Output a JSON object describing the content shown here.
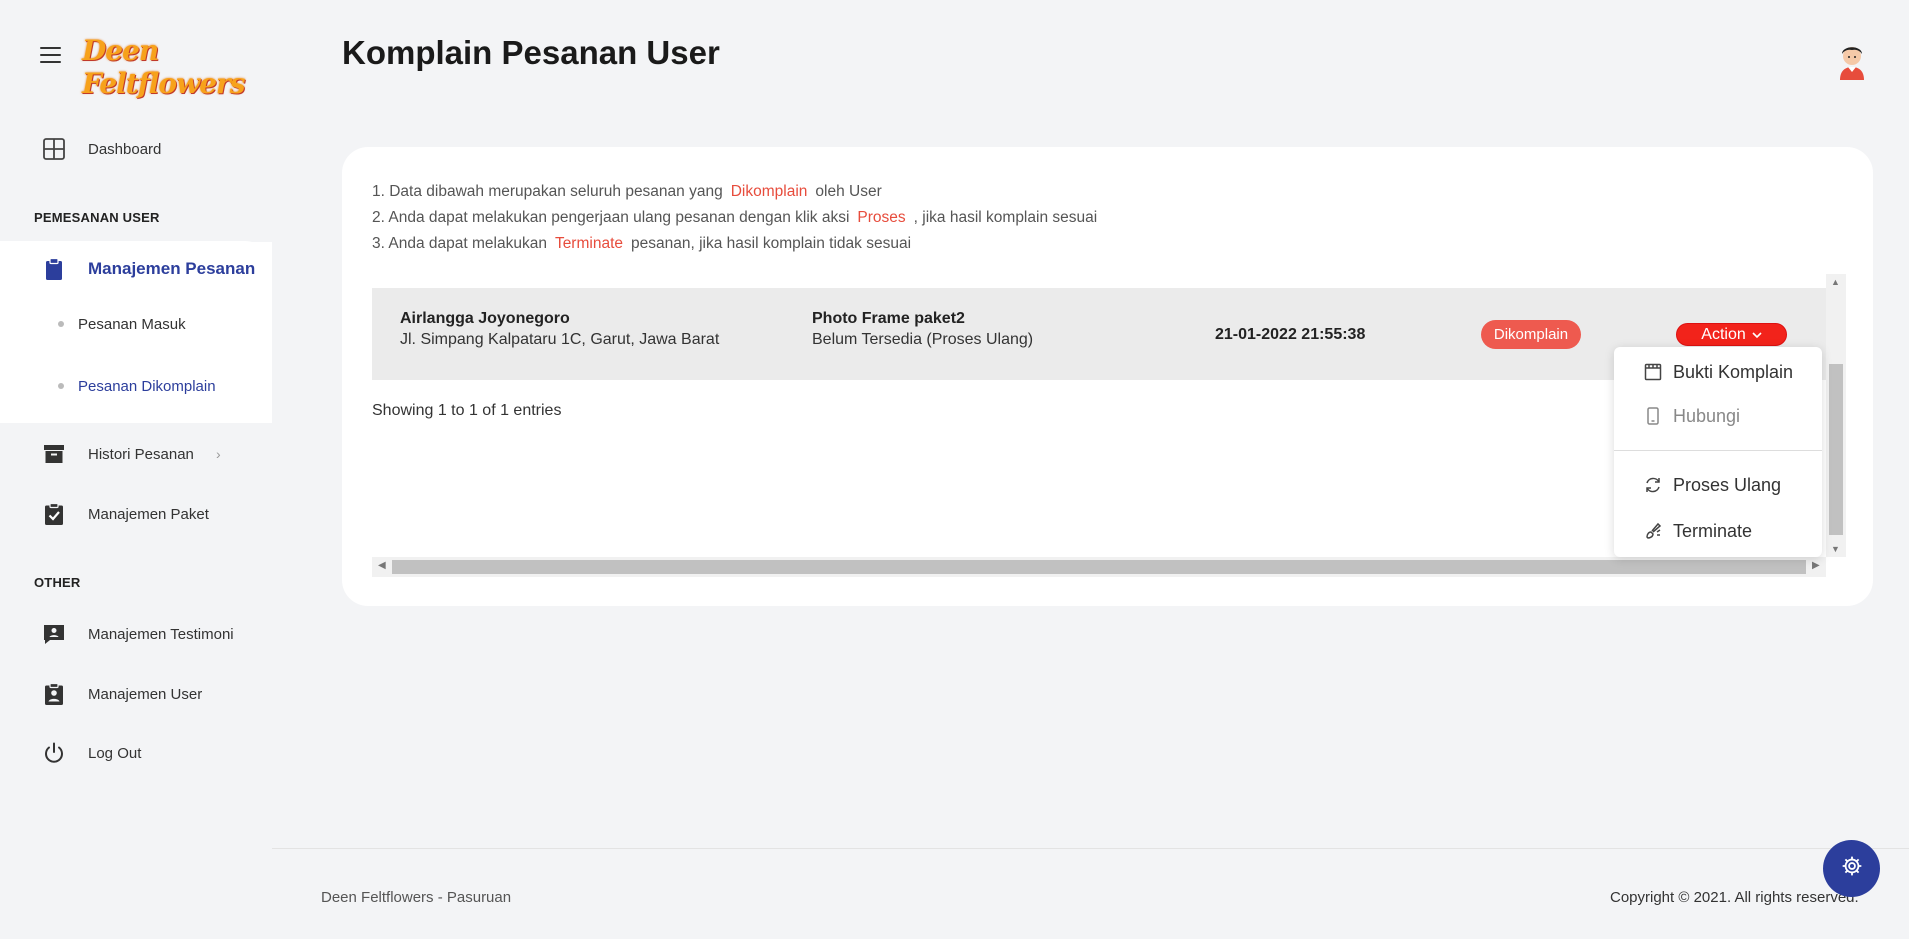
{
  "app": {
    "logo_text": "Deen Feltflowers",
    "page_title": "Komplain Pesanan User"
  },
  "sidebar": {
    "dashboard": "Dashboard",
    "section_user": "PEMESANAN USER",
    "manajemen_pesanan": "Manajemen Pesanan",
    "pesanan_masuk": "Pesanan Masuk",
    "pesanan_dikomplain": "Pesanan Dikomplain",
    "histori_pesanan": "Histori Pesanan",
    "manajemen_paket": "Manajemen Paket",
    "section_other": "OTHER",
    "manajemen_testimoni": "Manajemen Testimoni",
    "manajemen_user": "Manajemen User",
    "logout": "Log Out"
  },
  "notes": {
    "line1_a": "1. Data dibawah merupakan seluruh pesanan yang",
    "line1_hl": "Dikomplain",
    "line1_b": "oleh User",
    "line2_a": "2. Anda dapat melakukan pengerjaan ulang pesanan dengan klik aksi",
    "line2_hl": "Proses",
    "line2_b": ", jika hasil komplain sesuai",
    "line3_a": "3. Anda dapat melakukan",
    "line3_hl": "Terminate",
    "line3_b": "pesanan, jika hasil komplain tidak sesuai"
  },
  "table": {
    "row": {
      "customer_name": "Airlangga Joyonegoro",
      "customer_address": "Jl. Simpang Kalpataru 1C, Garut, Jawa Barat",
      "product": "Photo Frame paket2",
      "product_status": "Belum Tersedia (Proses Ulang)",
      "datetime": "21-01-2022 21:55:38",
      "status_badge": "Dikomplain",
      "action_label": "Action"
    },
    "entries_info": "Showing 1 to 1 of 1 entries"
  },
  "dropdown": {
    "bukti_komplain": "Bukti Komplain",
    "hubungi": "Hubungi",
    "proses_ulang": "Proses Ulang",
    "terminate": "Terminate"
  },
  "footer": {
    "left": "Deen Feltflowers - Pasuruan",
    "right": "Copyright © 2021. All rights reserved."
  },
  "colors": {
    "accent": "#2c3e9c",
    "danger": "#f2231b",
    "badge": "#ee5a4f",
    "highlight_text": "#e74c3c"
  }
}
